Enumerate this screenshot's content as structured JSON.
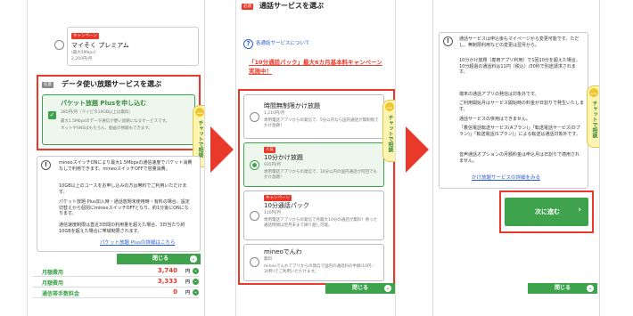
{
  "panel1": {
    "premium_badge": "キャンペーン",
    "premium_title": "マイそく プレミアム",
    "premium_speed": "(最大5Mbps)",
    "premium_price": "2,200円/月",
    "section_tag": "任意",
    "section_title": "データ使い放題サービスを選ぶ",
    "plus_label": "パケット放題 Plusを申し込む",
    "plus_price": "385円/月（マイピタ10GB以上は無料）",
    "plus_desc1": "最大1.5Mbpsのデータ通信が使い放題になるサービスです。",
    "plus_desc2": "ネットやSNSはもちろん、動画の視聴もできます。",
    "notes": [
      "mineoスイッチONにより最大1.5Mbpsの通信速度でパケット消費なしで利用できます。mineoスイッチOFFで容量消費。",
      "10GB以上のコースをお申し込みの方は無料でご利用いただけます。",
      "パケット放題 Plus加入時・通話放題未使用時・有料の場合、設定切替えから個別にmineoスイッチOFFとなり、約1分後にONになります。",
      "通信速度制限は直近3日間の利用量を超えた場合、3日当たり約10GBを超えた場合に帯域制限されます。"
    ],
    "link": "パケット放題 Plusの詳細はこちら",
    "close": "閉じる",
    "fees": [
      {
        "label": "月額費用",
        "amount": "3,740",
        "unit": "円"
      },
      {
        "label": "月額費用",
        "amount": "3,333",
        "unit": "円"
      },
      {
        "label": "通信帯手数料金",
        "amount": "0",
        "unit": "円"
      }
    ]
  },
  "panel2": {
    "title": "通話サービスを選ぶ",
    "title_tag": "必須",
    "about_link": "各通話サービスについて",
    "campaign": "「10分通話パック」最大6カ月基本料キャンペーン実施中！",
    "options": [
      {
        "name": "時間無制限かけ放題",
        "price": "1,210円/月",
        "desc": "専用電話アプリからの発信で、5分以内なら国内通話が無制限でかけ放題！",
        "badge": ""
      },
      {
        "name": "10分かけ放題",
        "price": "935円/月",
        "desc": "専用電話アプリからの発信で、10分以内の国内通話が何回でもかけ放題！",
        "badge": "人気"
      },
      {
        "name": "10分通話パック",
        "price": "110円/月",
        "desc": "専用電話アプリからの発信で月最大10分の通話が無料！余った通話時間は翌月末まで繰り越し可能。",
        "badge": "キャンペーン"
      },
      {
        "name": "mineoでんわ",
        "price": "無料",
        "desc": "mineoでんわアプリからの発信で国内の通話料の半額(10円／30秒)でご利用いただけます。",
        "badge": ""
      }
    ],
    "chat": "チャットで相談",
    "close": "閉じる"
  },
  "panel3": {
    "notes": [
      "通話サービスは申込後もマイページから変更可能です。ただし、無制限利用などの変更は翌月から。",
      "10分かけ放題（専用アプリ利用）で1回10分を超えた場合、10分超過の通話料は11円（税込）/30秒で別途請求されます。",
      "端末の通話アプリの発信は対象外です。",
      "ご利用開始月はサービス開始時の料金が日割りで発生いたします。",
      "通話サービスの併用はできません。",
      "「着信電話転送サービス(Aプラン)」「転送電話サービス(Dプラン)」「転送電話(Sプラン)」による転送は通話対象外です。",
      "音声通話オプションの月額料金は申込月は日割りで適用されません。"
    ],
    "link": "かけ放題サービスの詳細をみる",
    "next": "次に進む",
    "chat": "チャットで相談",
    "close": "閉じる"
  }
}
